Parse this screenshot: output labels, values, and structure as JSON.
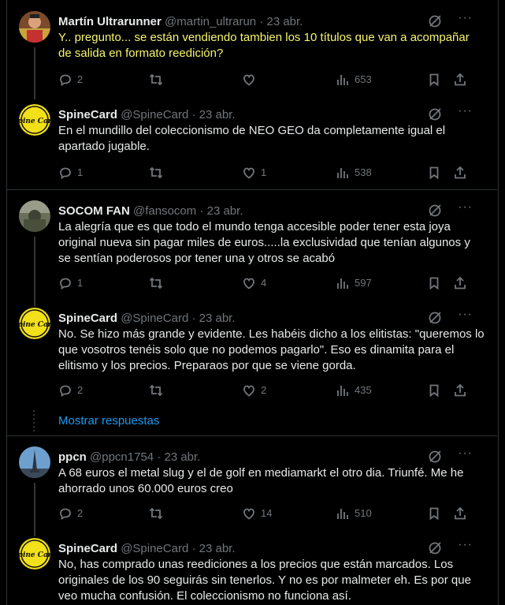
{
  "tweets": [
    {
      "name": "Martín Ultrarunner",
      "handle": "@martin_ultrarun",
      "date": "· 23 abr.",
      "text": "Y.. pregunto... se están vendiendo tambien los 10 títulos que van a acompañar de salida en formato reedición?",
      "replies": "2",
      "reposts": "",
      "likes": "",
      "views": "653"
    },
    {
      "name": "SpineCard",
      "handle": "@SpineCard",
      "date": "· 23 abr.",
      "text": "En el mundillo del coleccionismo de NEO GEO da completamente igual el apartado jugable.",
      "replies": "1",
      "reposts": "",
      "likes": "1",
      "views": "538"
    },
    {
      "name": "SOCOM FAN",
      "handle": "@fansocom",
      "date": "· 23 abr.",
      "text": "La alegría que es que todo el mundo tenga accesible poder tener esta joya original nueva sin pagar miles de euros.....la exclusividad que tenían algunos y se sentían poderosos por tener una y otros se acabó",
      "replies": "1",
      "reposts": "",
      "likes": "4",
      "views": "597"
    },
    {
      "name": "SpineCard",
      "handle": "@SpineCard",
      "date": "· 23 abr.",
      "text": "No. Se hizo más grande y evidente. Les habéis dicho a los elitistas: \"queremos lo que vosotros tenéis solo que no podemos pagarlo\". Eso es dinamita para el elitismo y los precios. Preparaos por que se viene gorda.",
      "replies": "2",
      "reposts": "",
      "likes": "2",
      "views": "435"
    },
    {
      "name": "ppcn",
      "handle": "@ppcn1754",
      "date": "· 23 abr.",
      "text": "A 68 euros el metal slug y el de golf en mediamarkt el otro dia. Triunfé. Me he ahorrado unos 60.000 euros creo",
      "replies": "2",
      "reposts": "",
      "likes": "14",
      "views": "510"
    },
    {
      "name": "SpineCard",
      "handle": "@SpineCard",
      "date": "· 23 abr.",
      "text": "No, has comprado unas reediciones a los precios que están marcados. Los originales de los 90 seguirás sin tenerlos. Y no es por malmeter eh. Es por que veo mucha confusión. El coleccionismo no funciona así."
    }
  ],
  "show_replies": "Mostrar respuestas",
  "avatar_text": "Spine Card",
  "colors": {
    "highlight_text": "#f5f56e",
    "link": "#1d9bf0",
    "muted": "#71767b"
  }
}
